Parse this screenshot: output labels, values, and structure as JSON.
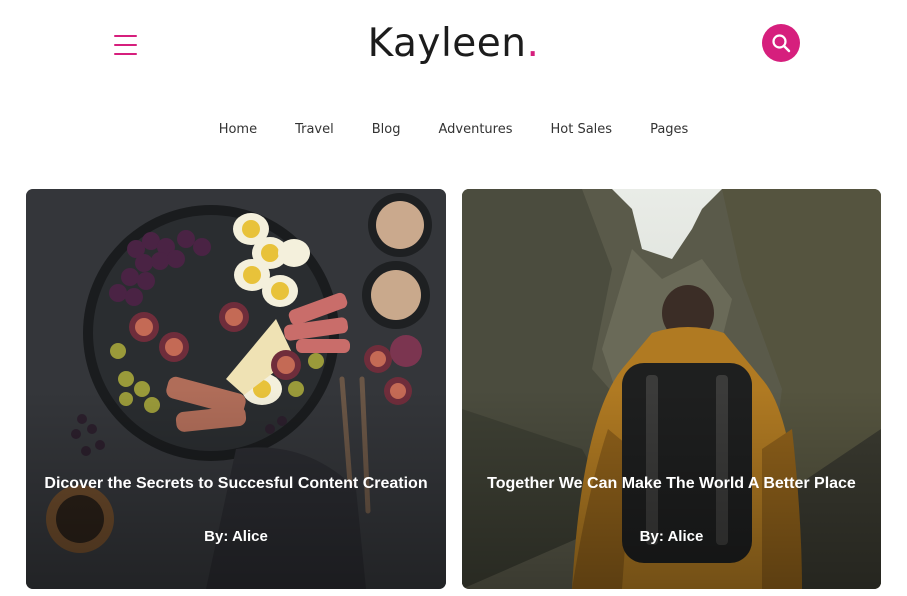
{
  "header": {
    "logo_text": "Kayleen",
    "logo_dot": ".",
    "accent_color": "#d61f7d"
  },
  "nav": {
    "items": [
      "Home",
      "Travel",
      "Blog",
      "Adventures",
      "Hot Sales",
      "Pages"
    ]
  },
  "posts": [
    {
      "title": "Dicover the Secrets to Succesful Content Creation",
      "author": "By: Alice",
      "image": "food-platter-photo"
    },
    {
      "title": "Together We Can Make The World A Better Place",
      "author": "By: Alice",
      "image": "hiker-mountains-photo"
    }
  ]
}
